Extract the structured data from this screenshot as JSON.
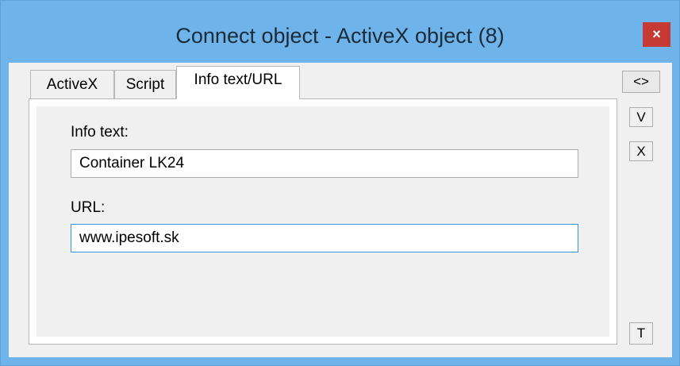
{
  "window": {
    "title": "Connect object - ActiveX object (8)",
    "close_label": "×",
    "title_bar_color": "#6eb3ea",
    "close_button_color": "#c53a35"
  },
  "tabs": [
    {
      "label": "ActiveX",
      "active": false
    },
    {
      "label": "Script",
      "active": false
    },
    {
      "label": "Info text/URL",
      "active": true
    }
  ],
  "form": {
    "info_text_label": "Info text:",
    "info_text_value": "Container LK24",
    "url_label": "URL:",
    "url_value": "www.ipesoft.sk"
  },
  "side_buttons": {
    "swap_label": "<>",
    "v_label": "V",
    "x_label": "X",
    "t_label": "T"
  }
}
